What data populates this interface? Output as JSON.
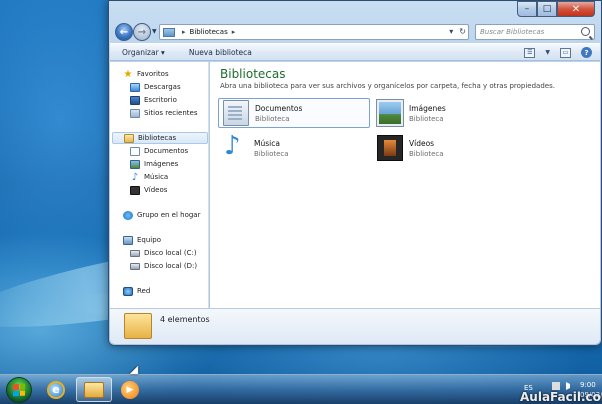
{
  "window": {
    "address": {
      "path": "Bibliotecas",
      "arrow": "▸"
    },
    "search": {
      "placeholder": "Buscar Bibliotecas"
    },
    "toolbar": {
      "organize_label": "Organizar",
      "new_library_label": "Nueva biblioteca"
    },
    "nav": {
      "favorites": "Favoritos",
      "downloads": "Descargas",
      "desktop": "Escritorio",
      "recent": "Sitios recientes",
      "libraries": "Bibliotecas",
      "documents": "Documentos",
      "images": "Imágenes",
      "music": "Música",
      "videos": "Vídeos",
      "homegroup": "Grupo en el hogar",
      "computer": "Equipo",
      "disk_c": "Disco local (C:)",
      "disk_d": "Disco local (D:)",
      "network": "Red"
    },
    "content": {
      "title": "Bibliotecas",
      "description": "Abra una biblioteca para ver sus archivos y organícelos por carpeta, fecha y otras propiedades.",
      "libraries": [
        {
          "name": "Documentos",
          "type": "Biblioteca",
          "icon": "documents-icon"
        },
        {
          "name": "Imágenes",
          "type": "Biblioteca",
          "icon": "pictures-icon"
        },
        {
          "name": "Música",
          "type": "Biblioteca",
          "icon": "music-icon"
        },
        {
          "name": "Vídeos",
          "type": "Biblioteca",
          "icon": "videos-icon"
        }
      ]
    },
    "details": {
      "count": "4 elementos"
    }
  },
  "taskbar": {
    "language": "ES",
    "time": "9:00",
    "date": "09/02/2",
    "apps": [
      "internet-explorer-icon",
      "windows-explorer-icon",
      "media-player-icon"
    ]
  },
  "watermark": "AulaFacil.com",
  "colors": {
    "accent_title": "#1e6d2c",
    "desktop": "#1b74bd"
  }
}
